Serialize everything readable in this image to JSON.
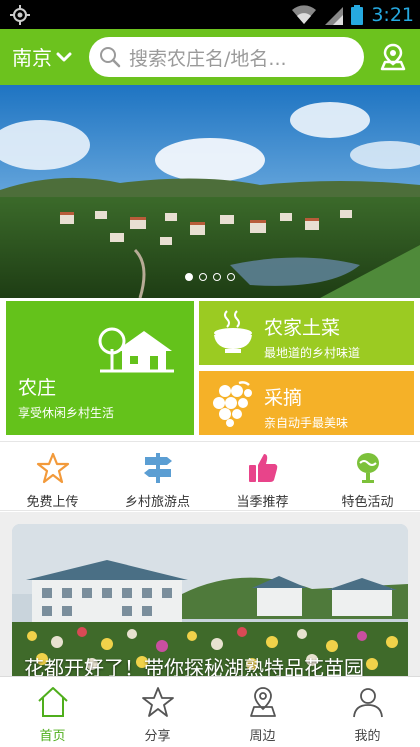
{
  "status_bar": {
    "time": "3:21",
    "icons": [
      "gps-icon",
      "wifi-icon",
      "signal-icon",
      "battery-icon"
    ]
  },
  "header": {
    "city": "南京",
    "search_placeholder": "搜索农庄名/地名...",
    "icons": [
      "chevron-down-icon",
      "search-icon",
      "location-icon"
    ]
  },
  "banner": {
    "slide_count": 4,
    "active_slide": 1
  },
  "categories": {
    "farm": {
      "title": "农庄",
      "subtitle": "享受休闲乡村生活"
    },
    "food": {
      "title": "农家土菜",
      "subtitle": "最地道的乡村味道"
    },
    "pick": {
      "title": "采摘",
      "subtitle": "亲自动手最美味"
    }
  },
  "quick_links": [
    {
      "label": "免费上传",
      "icon": "star-icon"
    },
    {
      "label": "乡村旅游点",
      "icon": "signpost-icon"
    },
    {
      "label": "当季推荐",
      "icon": "thumbs-up-icon"
    },
    {
      "label": "特色活动",
      "icon": "activity-icon"
    }
  ],
  "feature": {
    "title": "花都开好了！带你探秘湖熟特品花苗园"
  },
  "bottom_nav": [
    {
      "label": "首页",
      "icon": "home-icon",
      "active": true
    },
    {
      "label": "分享",
      "icon": "star-icon"
    },
    {
      "label": "周边",
      "icon": "location-icon"
    },
    {
      "label": "我的",
      "icon": "user-icon"
    }
  ],
  "colors": {
    "brand_green": "#6cc21e",
    "farm_tile": "#64c21b",
    "food_tile": "#9bcb22",
    "pick_tile": "#f5b128",
    "active_tab": "#4fae1c",
    "time_blue": "#26a9e0"
  }
}
